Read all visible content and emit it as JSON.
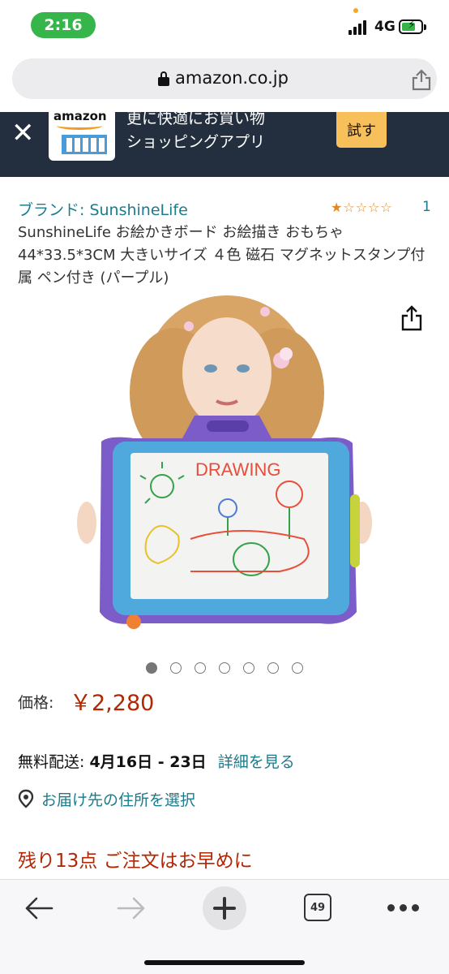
{
  "status_bar": {
    "time": "2:16",
    "network": "4G",
    "colors": {
      "time_pill": "#36b54a"
    }
  },
  "url_bar": {
    "url": "amazon.co.jp",
    "icons": [
      "lock-icon",
      "share-icon"
    ]
  },
  "app_banner": {
    "logo_text": "amazon",
    "line1": "更に快適にお買い物",
    "line2": "ショッピングアプリ",
    "button_label": "試す",
    "colors": {
      "background": "#232f3e",
      "button": "#f8c05a"
    }
  },
  "product": {
    "brand_link": "ブランド: SunshineLife",
    "rating_stars": 1,
    "rating_max": 5,
    "review_count": "1",
    "title": "SunshineLife お絵かきボード お絵描き おもちゃ 44*33.5*3CM 大きいサイズ ４色 磁石 マグネットスタンプ付属 ペン付き (パープル)",
    "image_text": "DRAWING",
    "image_count": 7,
    "active_image": 1
  },
  "pricing": {
    "label": "価格:",
    "value": "￥2,280",
    "color": "#b12704"
  },
  "delivery": {
    "label": "無料配送:",
    "dates": "4月16日 - 23日",
    "details_link": "詳細を見る",
    "location_link": "お届け先の住所を選択"
  },
  "stock": {
    "text": "残り13点 ご注文はお早めに"
  },
  "toolbar": {
    "tab_count": "49",
    "icons": [
      "back-arrow-icon",
      "forward-arrow-icon",
      "new-tab-plus-icon",
      "tabs-icon",
      "more-icon"
    ]
  }
}
